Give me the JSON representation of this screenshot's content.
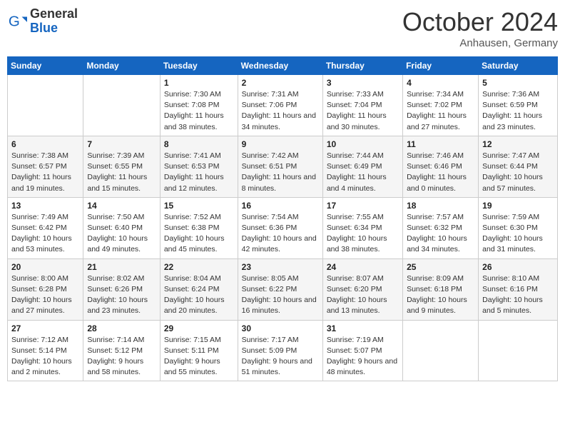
{
  "header": {
    "logo": {
      "general": "General",
      "blue": "Blue"
    },
    "title": "October 2024",
    "location": "Anhausen, Germany"
  },
  "weekdays": [
    "Sunday",
    "Monday",
    "Tuesday",
    "Wednesday",
    "Thursday",
    "Friday",
    "Saturday"
  ],
  "weeks": [
    [
      null,
      null,
      {
        "day": 1,
        "sunrise": "7:30 AM",
        "sunset": "7:08 PM",
        "daylight": "11 hours and 38 minutes."
      },
      {
        "day": 2,
        "sunrise": "7:31 AM",
        "sunset": "7:06 PM",
        "daylight": "11 hours and 34 minutes."
      },
      {
        "day": 3,
        "sunrise": "7:33 AM",
        "sunset": "7:04 PM",
        "daylight": "11 hours and 30 minutes."
      },
      {
        "day": 4,
        "sunrise": "7:34 AM",
        "sunset": "7:02 PM",
        "daylight": "11 hours and 27 minutes."
      },
      {
        "day": 5,
        "sunrise": "7:36 AM",
        "sunset": "6:59 PM",
        "daylight": "11 hours and 23 minutes."
      }
    ],
    [
      {
        "day": 6,
        "sunrise": "7:38 AM",
        "sunset": "6:57 PM",
        "daylight": "11 hours and 19 minutes."
      },
      {
        "day": 7,
        "sunrise": "7:39 AM",
        "sunset": "6:55 PM",
        "daylight": "11 hours and 15 minutes."
      },
      {
        "day": 8,
        "sunrise": "7:41 AM",
        "sunset": "6:53 PM",
        "daylight": "11 hours and 12 minutes."
      },
      {
        "day": 9,
        "sunrise": "7:42 AM",
        "sunset": "6:51 PM",
        "daylight": "11 hours and 8 minutes."
      },
      {
        "day": 10,
        "sunrise": "7:44 AM",
        "sunset": "6:49 PM",
        "daylight": "11 hours and 4 minutes."
      },
      {
        "day": 11,
        "sunrise": "7:46 AM",
        "sunset": "6:46 PM",
        "daylight": "11 hours and 0 minutes."
      },
      {
        "day": 12,
        "sunrise": "7:47 AM",
        "sunset": "6:44 PM",
        "daylight": "10 hours and 57 minutes."
      }
    ],
    [
      {
        "day": 13,
        "sunrise": "7:49 AM",
        "sunset": "6:42 PM",
        "daylight": "10 hours and 53 minutes."
      },
      {
        "day": 14,
        "sunrise": "7:50 AM",
        "sunset": "6:40 PM",
        "daylight": "10 hours and 49 minutes."
      },
      {
        "day": 15,
        "sunrise": "7:52 AM",
        "sunset": "6:38 PM",
        "daylight": "10 hours and 45 minutes."
      },
      {
        "day": 16,
        "sunrise": "7:54 AM",
        "sunset": "6:36 PM",
        "daylight": "10 hours and 42 minutes."
      },
      {
        "day": 17,
        "sunrise": "7:55 AM",
        "sunset": "6:34 PM",
        "daylight": "10 hours and 38 minutes."
      },
      {
        "day": 18,
        "sunrise": "7:57 AM",
        "sunset": "6:32 PM",
        "daylight": "10 hours and 34 minutes."
      },
      {
        "day": 19,
        "sunrise": "7:59 AM",
        "sunset": "6:30 PM",
        "daylight": "10 hours and 31 minutes."
      }
    ],
    [
      {
        "day": 20,
        "sunrise": "8:00 AM",
        "sunset": "6:28 PM",
        "daylight": "10 hours and 27 minutes."
      },
      {
        "day": 21,
        "sunrise": "8:02 AM",
        "sunset": "6:26 PM",
        "daylight": "10 hours and 23 minutes."
      },
      {
        "day": 22,
        "sunrise": "8:04 AM",
        "sunset": "6:24 PM",
        "daylight": "10 hours and 20 minutes."
      },
      {
        "day": 23,
        "sunrise": "8:05 AM",
        "sunset": "6:22 PM",
        "daylight": "10 hours and 16 minutes."
      },
      {
        "day": 24,
        "sunrise": "8:07 AM",
        "sunset": "6:20 PM",
        "daylight": "10 hours and 13 minutes."
      },
      {
        "day": 25,
        "sunrise": "8:09 AM",
        "sunset": "6:18 PM",
        "daylight": "10 hours and 9 minutes."
      },
      {
        "day": 26,
        "sunrise": "8:10 AM",
        "sunset": "6:16 PM",
        "daylight": "10 hours and 5 minutes."
      }
    ],
    [
      {
        "day": 27,
        "sunrise": "7:12 AM",
        "sunset": "5:14 PM",
        "daylight": "10 hours and 2 minutes."
      },
      {
        "day": 28,
        "sunrise": "7:14 AM",
        "sunset": "5:12 PM",
        "daylight": "9 hours and 58 minutes."
      },
      {
        "day": 29,
        "sunrise": "7:15 AM",
        "sunset": "5:11 PM",
        "daylight": "9 hours and 55 minutes."
      },
      {
        "day": 30,
        "sunrise": "7:17 AM",
        "sunset": "5:09 PM",
        "daylight": "9 hours and 51 minutes."
      },
      {
        "day": 31,
        "sunrise": "7:19 AM",
        "sunset": "5:07 PM",
        "daylight": "9 hours and 48 minutes."
      },
      null,
      null
    ]
  ]
}
